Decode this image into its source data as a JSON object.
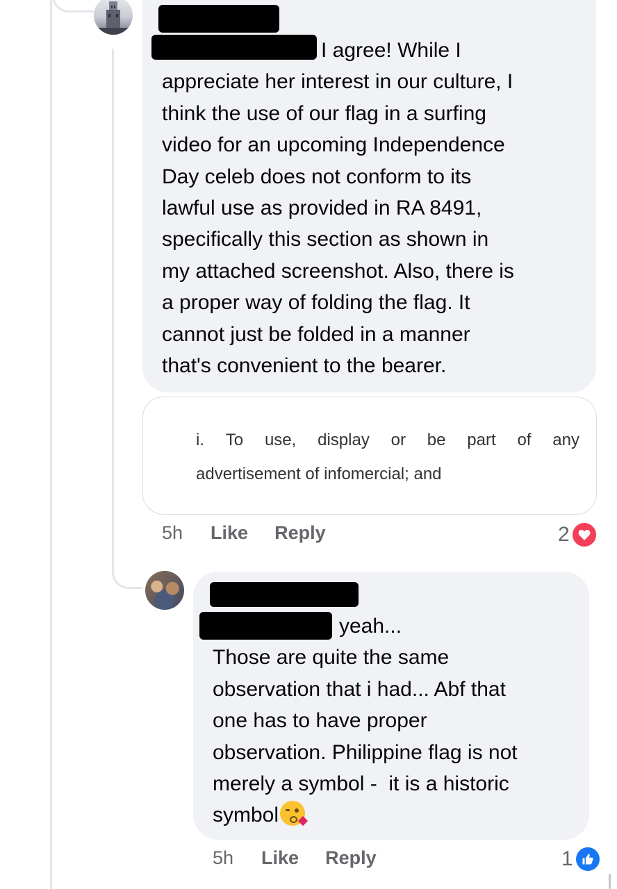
{
  "comments": [
    {
      "author_hidden": true,
      "mention_hidden": true,
      "lead_text": "I agree! While I",
      "body": "appreciate her interest in our culture, I\nthink the use of our flag in a surfing\nvideo for an upcoming Independence\nDay celeb does not conform to its\nlawful use as provided in RA 8491,\nspecifically this section as shown in\nmy attached screenshot. Also, there is\na proper way of folding the flag. It\ncannot just be folded in a manner\nthat's convenient to the bearer.",
      "attachment": {
        "line1_words": [
          "i.",
          "To",
          "use,",
          "display",
          "or",
          "be",
          "part",
          "of",
          "any"
        ],
        "line2": "advertisement of infomercial; and"
      },
      "time": "5h",
      "like_label": "Like",
      "reply_label": "Reply",
      "reaction_count": "2",
      "reaction_icon": "heart-icon",
      "reaction_color": "#f33e58"
    },
    {
      "author_hidden": true,
      "mention_hidden": true,
      "lead_text": "yeah...",
      "body": "Those are quite the same\nobservation that i had... Abf that\none has to have proper\nobservation. Philippine flag is not\nmerely a symbol -  it is a historic\nsymbol",
      "emoji": "kissing-face-emoji",
      "time": "5h",
      "like_label": "Like",
      "reply_label": "Reply",
      "reaction_count": "1",
      "reaction_icon": "thumbs-up-icon",
      "reaction_color": "#1877f2"
    }
  ],
  "colors": {
    "bubble": "#f0f2f5",
    "meta_text": "#65676b",
    "thread_line": "#e4e6eb"
  }
}
